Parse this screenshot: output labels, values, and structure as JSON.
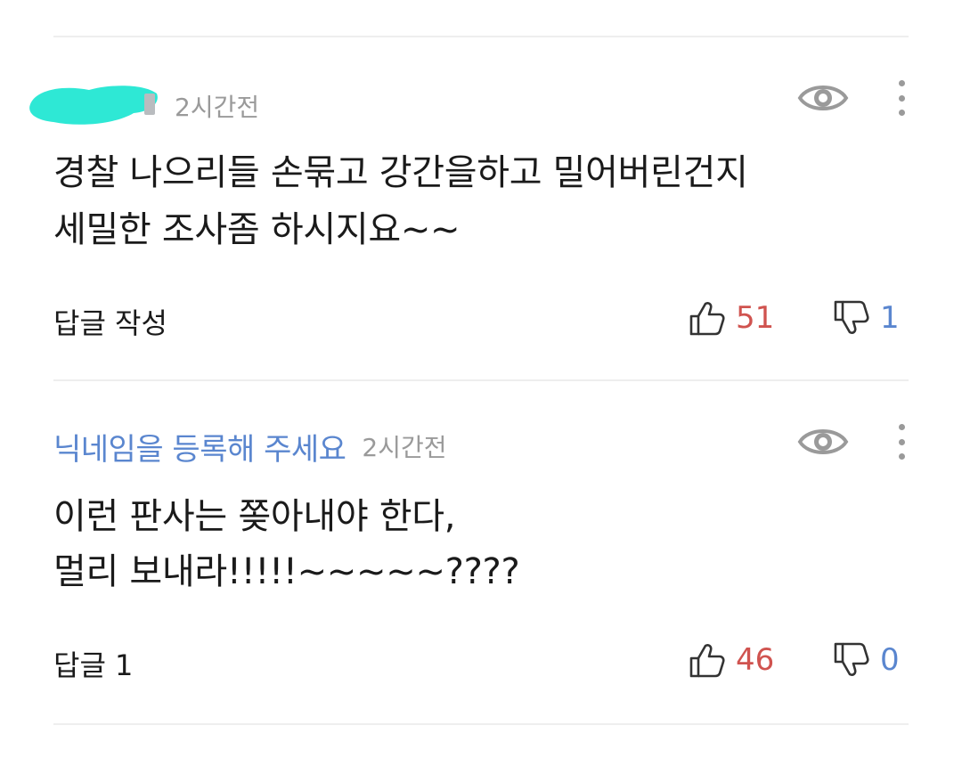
{
  "colors": {
    "author": "#5a86cf",
    "upvote_count": "#d0534f",
    "downvote_count": "#5a86cf",
    "meta": "#9a9a9a",
    "redaction_mask": "#2ee8d5"
  },
  "comments": [
    {
      "author": "",
      "author_redacted": true,
      "time": "2시간전",
      "view_icon": "eye-icon",
      "more_icon": "more-vertical-icon",
      "body_lines": [
        "경찰 나으리들 손묶고 강간을하고 밀어버린건지",
        "세밀한 조사좀 하시지요~~"
      ],
      "reply_label": "답글 작성",
      "likes": "51",
      "dislikes": "1"
    },
    {
      "author": "닉네임을 등록해 주세요",
      "author_redacted": false,
      "time": "2시간전",
      "view_icon": "eye-icon",
      "more_icon": "more-vertical-icon",
      "body_lines": [
        "이런 판사는 쫒아내야 한다,",
        "멀리 보내라!!!!!~~~~~????"
      ],
      "reply_label": "답글 1",
      "likes": "46",
      "dislikes": "0"
    }
  ]
}
